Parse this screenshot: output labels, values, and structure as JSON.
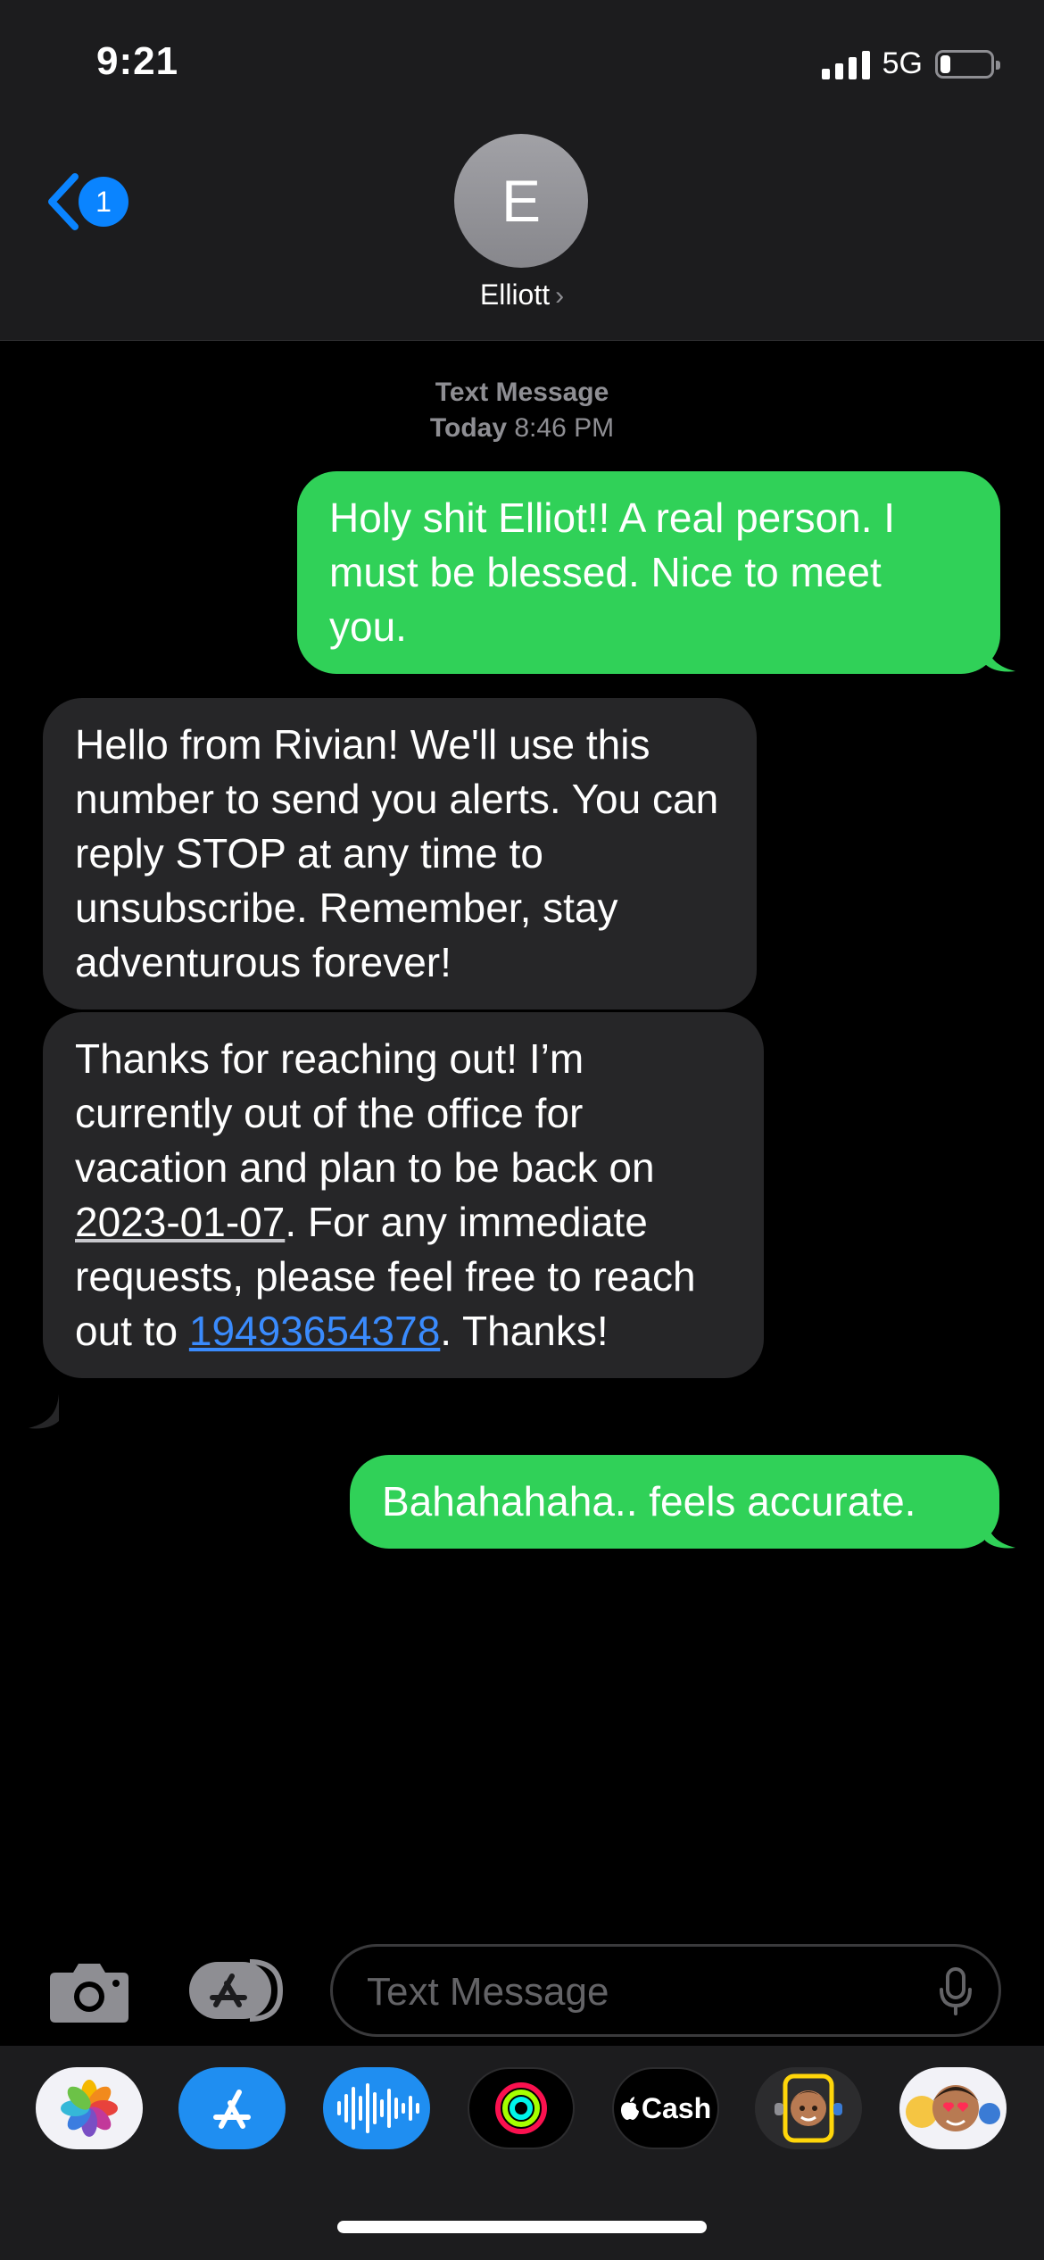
{
  "status": {
    "time": "9:21",
    "network": "5G",
    "battery_percent": 20
  },
  "header": {
    "back_badge": "1",
    "avatar_initial": "E",
    "contact_name": "Elliott",
    "chevron": "›"
  },
  "conversation": {
    "service_label": "Text Message",
    "timestamp_day": "Today",
    "timestamp_time": "8:46 PM",
    "messages": [
      {
        "direction": "sent",
        "text": "Holy shit Elliot!! A real person. I must be blessed. Nice to meet you."
      },
      {
        "direction": "received",
        "text": "Hello from Rivian! We'll use this number to send you alerts. You can reply STOP at any time to unsubscribe. Remember, stay adventurous forever!"
      },
      {
        "direction": "received",
        "text_before_date": "Thanks for reaching out! I’m currently out of the office for vacation and plan to be back on ",
        "date": "2023-01-07",
        "text_before_phone": ". For any immediate requests, please feel free to reach out to ",
        "phone": "19493654378",
        "text_after_phone": ". Thanks!"
      },
      {
        "direction": "sent",
        "text": "Bahahahaha.. feels accurate."
      }
    ]
  },
  "composer": {
    "placeholder": "Text Message"
  },
  "app_tray": {
    "apps": [
      {
        "name": "Photos",
        "icon": "photos-icon"
      },
      {
        "name": "App Store",
        "icon": "app-store-icon"
      },
      {
        "name": "Audio Message",
        "icon": "audio-waveform-icon"
      },
      {
        "name": "Fitness",
        "icon": "activity-rings-icon"
      },
      {
        "name": "Apple Cash",
        "icon": "apple-cash-icon",
        "label": "Cash"
      },
      {
        "name": "Memoji",
        "icon": "memoji-icon"
      },
      {
        "name": "Memoji Stickers",
        "icon": "memoji-stickers-icon"
      }
    ]
  },
  "colors": {
    "sent_bubble": "#30d158",
    "received_bubble": "#262628",
    "link": "#3a8bfd",
    "accent": "#0a84ff"
  }
}
